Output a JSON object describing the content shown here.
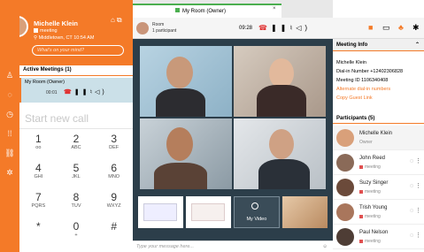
{
  "user": {
    "name": "Michelle Klein",
    "status": "meeting",
    "location": "Middletown, CT  10:54 AM",
    "mind_placeholder": "What's on your mind?"
  },
  "active_meetings": {
    "title": "Active Meetings (1)",
    "meeting_name": "My Room (Owner)",
    "timer": "00:01"
  },
  "dialpad": {
    "placeholder": "Start new call",
    "keys": [
      {
        "d": "1",
        "s": "oo"
      },
      {
        "d": "2",
        "s": "ABC"
      },
      {
        "d": "3",
        "s": "DEF"
      },
      {
        "d": "4",
        "s": "GHI"
      },
      {
        "d": "5",
        "s": "JKL"
      },
      {
        "d": "6",
        "s": "MNO"
      },
      {
        "d": "7",
        "s": "PQRS"
      },
      {
        "d": "8",
        "s": "TUV"
      },
      {
        "d": "9",
        "s": "WXYZ"
      },
      {
        "d": "*",
        "s": ""
      },
      {
        "d": "0",
        "s": "+"
      },
      {
        "d": "#",
        "s": ""
      }
    ]
  },
  "tab": {
    "label": "My Room (Owner)",
    "close": "×"
  },
  "meeting_controls": {
    "room_label": "Room",
    "participants_label": "1 participant",
    "timer": "09:28"
  },
  "video": {
    "my_video_label": "My Video"
  },
  "chat": {
    "placeholder": "Type your message here..."
  },
  "meeting_info": {
    "title": "Meeting Info",
    "owner": "Michelle Klein",
    "dial_in": "Dial-in Number +12402306828",
    "meeting_id": "Meeting ID 1106340408",
    "alt_numbers": "Alternate dial-in numbers",
    "copy_link": "Copy Guest Link"
  },
  "participants": {
    "title": "Participants (5)",
    "list": [
      {
        "name": "Michelle Klein",
        "status": "Owner",
        "color": "#d9a07a"
      },
      {
        "name": "John Reed",
        "status": "meeting",
        "color": "#8a6a58"
      },
      {
        "name": "Suzy Singer",
        "status": "meeting",
        "color": "#6b4a3a"
      },
      {
        "name": "Trish Young",
        "status": "meeting",
        "color": "#a9765c"
      },
      {
        "name": "Paul Nelson",
        "status": "meeting",
        "color": "#4e3d35"
      }
    ]
  },
  "colors": {
    "brand": "#f47a28",
    "stage": "#2c3e4a",
    "end_call": "#e03030",
    "active": "#4caf50"
  }
}
